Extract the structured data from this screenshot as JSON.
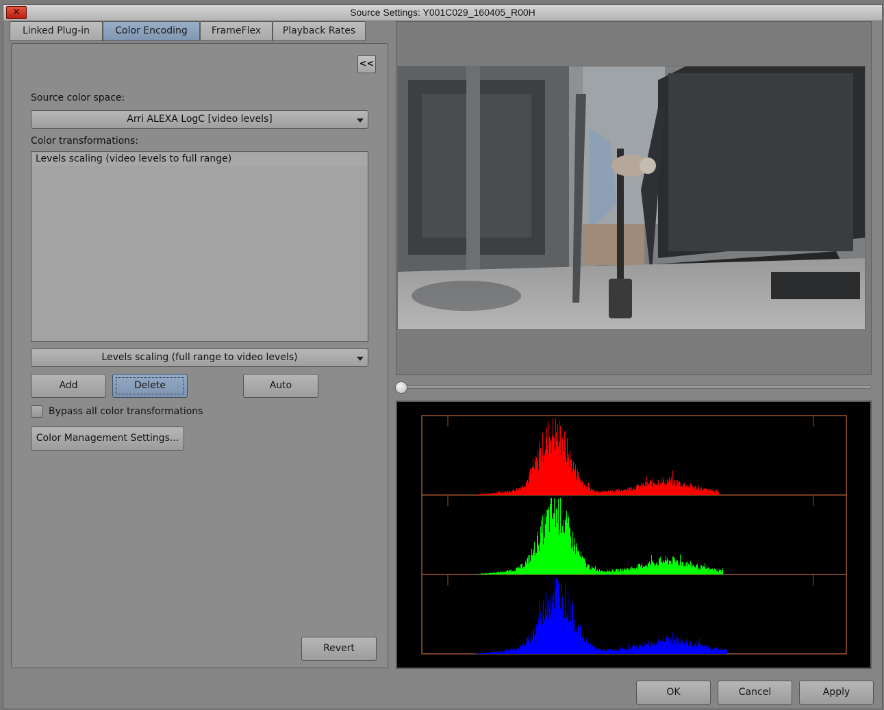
{
  "window": {
    "title": "Source Settings: Y001C029_160405_R00H"
  },
  "tabs": [
    {
      "label": "Linked Plug-in",
      "active": false
    },
    {
      "label": "Color Encoding",
      "active": true
    },
    {
      "label": "FrameFlex",
      "active": false
    },
    {
      "label": "Playback Rates",
      "active": false
    }
  ],
  "collapse_label": "<<",
  "source_color_space": {
    "label": "Source color space:",
    "value": "Arri ALEXA LogC [video levels]"
  },
  "color_transformations": {
    "label": "Color transformations:",
    "items": [
      "Levels scaling (video levels to full range)"
    ],
    "selector_value": "Levels scaling (full range to video levels)"
  },
  "buttons": {
    "add": "Add",
    "delete": "Delete",
    "auto": "Auto",
    "color_management": "Color Management Settings...",
    "revert": "Revert",
    "ok": "OK",
    "cancel": "Cancel",
    "apply": "Apply"
  },
  "bypass": {
    "label": "Bypass all color transformations",
    "checked": false
  },
  "playhead_fraction": 0.0,
  "histogram": {
    "channels": [
      {
        "name": "red",
        "color": "#ff0000"
      },
      {
        "name": "green",
        "color": "#00ff00"
      },
      {
        "name": "blue",
        "color": "#0000ff"
      }
    ],
    "frame_color": "#a0522d"
  },
  "colors": {
    "active_tab": "#8ea3bf",
    "panel": "#8c8c8c"
  }
}
